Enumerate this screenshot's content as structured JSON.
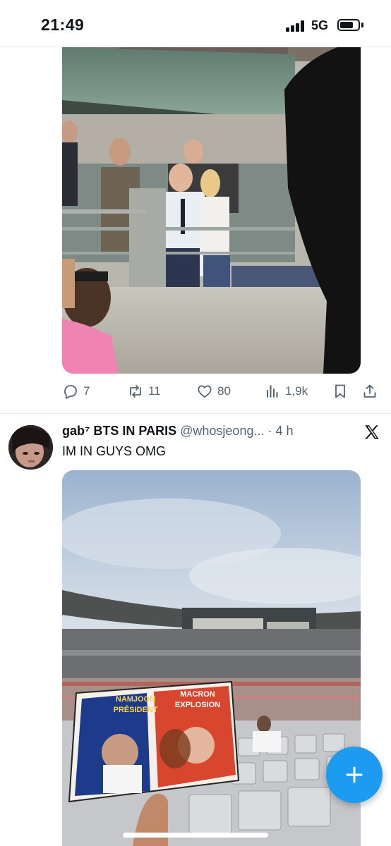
{
  "status_bar": {
    "time": "21:49",
    "network": "5G",
    "icons": [
      "cellular-signal-icon",
      "battery-icon"
    ]
  },
  "tweet1": {
    "media_description": "Stadium VIP box photo",
    "actions": {
      "replies": "7",
      "retweets": "11",
      "likes": "80",
      "views": "1,9k"
    }
  },
  "tweet2": {
    "author_name": "gab⁷ BTS IN PARIS",
    "author_handle": "@whosjeong...",
    "separator": " · ",
    "timestamp": "4 h",
    "text": "IM IN GUYS OMG",
    "sign_text_left_1": "NAMJOON",
    "sign_text_left_2": "PRÉSIDENT",
    "sign_text_right_1": "MACRON",
    "sign_text_right_2": "EXPLOSION"
  },
  "colors": {
    "accent": "#1d9bf0",
    "muted": "#536471",
    "text": "#0f1419"
  }
}
